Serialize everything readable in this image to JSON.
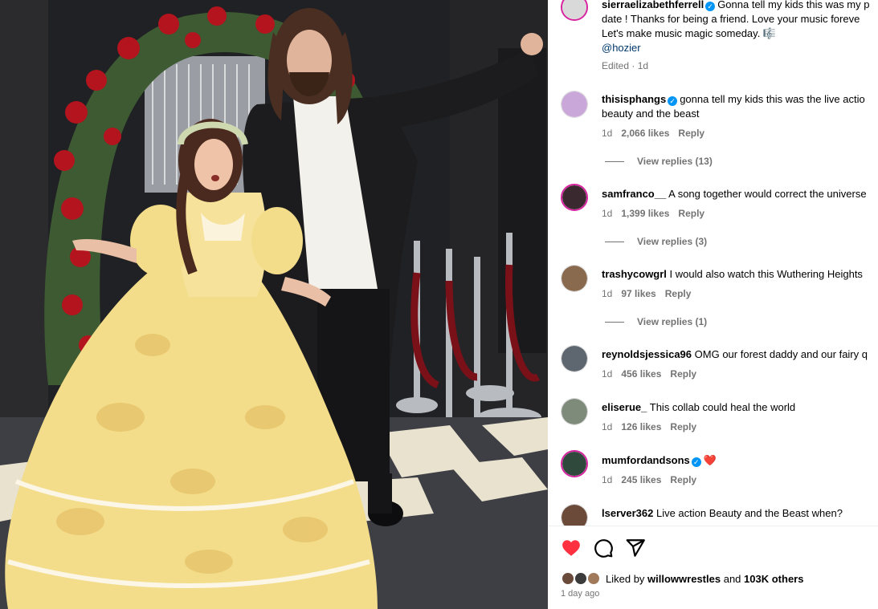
{
  "post": {
    "author": "sierraelizabethferrell",
    "caption_line1": "Gonna tell my kids this was my p",
    "caption_line2": "date ! Thanks for being a friend. Love your music foreve",
    "caption_line3": "Let's make music magic someday. 🎼",
    "mention": "@hozier",
    "edited": "Edited · 1d"
  },
  "comments": [
    {
      "user": "thisisphangs",
      "verified": true,
      "text_line1": "gonna tell my kids this was the live actio",
      "text_line2": "beauty and the beast",
      "age": "1d",
      "likes": "2,066 likes",
      "reply": "Reply",
      "view_replies": "View replies (13)",
      "avatar_color": "#c9a7d8"
    },
    {
      "user": "samfranco__",
      "verified": false,
      "text_line1": "A song together would correct the universe",
      "age": "1d",
      "likes": "1,399 likes",
      "reply": "Reply",
      "view_replies": "View replies (3)",
      "avatar_color": "#3a2a30"
    },
    {
      "user": "trashycowgrl",
      "verified": false,
      "text_line1": "I would also watch this Wuthering Heights",
      "age": "1d",
      "likes": "97 likes",
      "reply": "Reply",
      "view_replies": "View replies (1)",
      "avatar_color": "#8a6a4e"
    },
    {
      "user": "reynoldsjessica96",
      "verified": false,
      "text_line1": "OMG our forest daddy and our fairy q",
      "age": "1d",
      "likes": "456 likes",
      "reply": "Reply",
      "avatar_color": "#5e6670"
    },
    {
      "user": "eliserue_",
      "verified": false,
      "text_line1": "This collab could heal the world",
      "age": "1d",
      "likes": "126 likes",
      "reply": "Reply",
      "avatar_color": "#7e8a7a"
    },
    {
      "user": "mumfordandsons",
      "verified": true,
      "text_line1": "❤️",
      "age": "1d",
      "likes": "245 likes",
      "reply": "Reply",
      "avatar_color": "#2f4a3d"
    },
    {
      "user": "lserver362",
      "verified": false,
      "text_line1": "Live action Beauty and the Beast when?",
      "avatar_color": "#6b4a3a"
    }
  ],
  "actions": {
    "like_icon": "heart-filled-icon",
    "comment_icon": "comment-icon",
    "share_icon": "share-icon",
    "like_color": "#ff3040"
  },
  "liked_by": {
    "prefix": "Liked by",
    "user": "willowwrestles",
    "and": "and",
    "others": "103K others"
  },
  "age": "1 day ago"
}
